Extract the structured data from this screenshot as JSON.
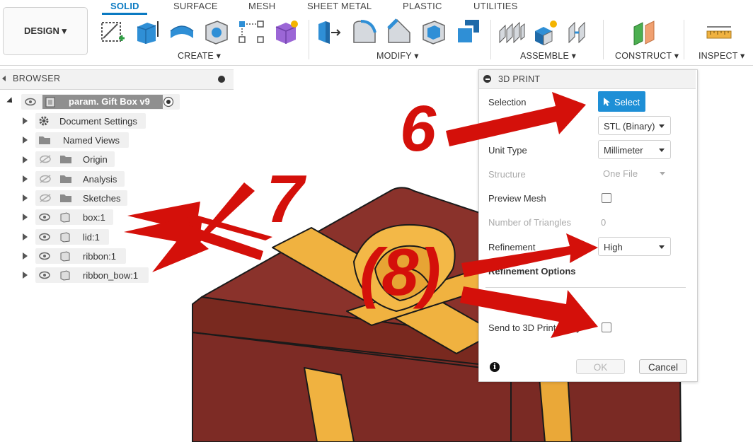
{
  "workspace": {
    "label": "DESIGN ▾"
  },
  "tabs": [
    {
      "label": "SOLID",
      "active": true
    },
    {
      "label": "SURFACE"
    },
    {
      "label": "MESH"
    },
    {
      "label": "SHEET METAL"
    },
    {
      "label": "PLASTIC"
    },
    {
      "label": "UTILITIES"
    }
  ],
  "groups": {
    "create": "CREATE ▾",
    "modify": "MODIFY ▾",
    "assemble": "ASSEMBLE ▾",
    "construct": "CONSTRUCT ▾",
    "inspect": "INSPECT ▾"
  },
  "browser": {
    "title": "BROWSER",
    "root": "param. Gift Box v9",
    "items": [
      {
        "label": "Document Settings",
        "icon": "gear-icon"
      },
      {
        "label": "Named Views",
        "icon": "folder-icon"
      },
      {
        "label": "Origin",
        "icon": "folder-icon",
        "hidden": true
      },
      {
        "label": "Analysis",
        "icon": "folder-icon",
        "hidden": true
      },
      {
        "label": "Sketches",
        "icon": "folder-icon",
        "hidden": true
      },
      {
        "label": "box:1",
        "icon": "body-icon"
      },
      {
        "label": "lid:1",
        "icon": "body-icon"
      },
      {
        "label": "ribbon:1",
        "icon": "body-icon"
      },
      {
        "label": "ribbon_bow:1",
        "icon": "body-icon"
      }
    ]
  },
  "dialog": {
    "title": "3D PRINT",
    "selection_label": "Selection",
    "select_button": "Select",
    "format_value": "STL (Binary)",
    "unit_type_label": "Unit Type",
    "unit_type_value": "Millimeter",
    "structure_label": "Structure",
    "structure_value": "One File",
    "preview_mesh_label": "Preview Mesh",
    "triangles_label": "Number of Triangles",
    "triangles_value": "0",
    "refinement_label": "Refinement",
    "refinement_value": "High",
    "refinement_options_label": "Refinement Options",
    "send_label": "Send to 3D Print Utility",
    "ok": "OK",
    "cancel": "Cancel"
  },
  "annotations": {
    "six": "6",
    "seven": "7",
    "eight": "(8)"
  },
  "colors": {
    "accent": "#0a7ac2",
    "arrow": "#d4100a",
    "box": "#84302a",
    "ribbon": "#efb13f"
  }
}
